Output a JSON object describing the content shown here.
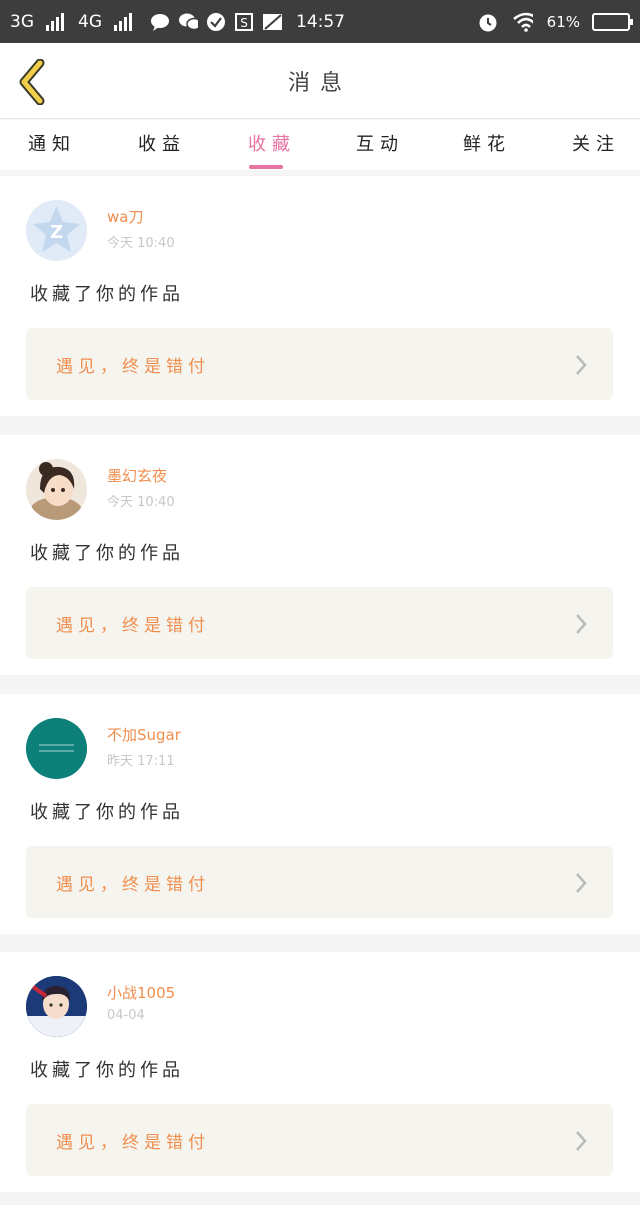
{
  "status_bar": {
    "network1": "3G",
    "network2": "4G",
    "time": "14:57",
    "battery": "61%"
  },
  "header": {
    "title": "消息"
  },
  "tabs": [
    {
      "label": "通知"
    },
    {
      "label": "收益"
    },
    {
      "label": "收藏",
      "active": true
    },
    {
      "label": "互动"
    },
    {
      "label": "鲜花"
    },
    {
      "label": "关注"
    }
  ],
  "colors": {
    "accent_pink": "#e774a0",
    "accent_orange": "#f08e4e",
    "card_bg": "#f5f4ee"
  },
  "items": [
    {
      "user": "wa刀",
      "time": "今天 10:40",
      "action": "收藏了你的作品",
      "work": "遇见，终是错付",
      "avatar": "qq-default-avatar"
    },
    {
      "user": "墨幻玄夜",
      "time": "今天 10:40",
      "action": "收藏了你的作品",
      "work": "遇见，终是错付",
      "avatar": "anime-girl-avatar"
    },
    {
      "user": "不加Sugar",
      "time": "昨天 17:11",
      "action": "收藏了你的作品",
      "work": "遇见，终是错付",
      "avatar": "teal-text-avatar"
    },
    {
      "user": "小战1005",
      "time": "04-04",
      "action": "收藏了你的作品",
      "work": "遇见，终是错付",
      "avatar": "boy-photo-avatar"
    }
  ]
}
